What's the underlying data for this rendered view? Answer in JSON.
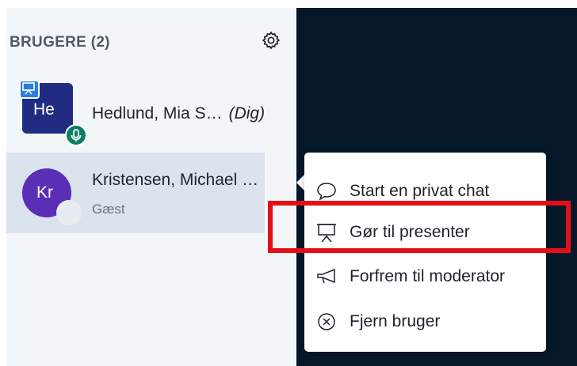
{
  "users_panel": {
    "title": "BRUGERE (2)",
    "users": [
      {
        "initials": "He",
        "name": "Hedlund, Mia S…",
        "you_tag": "(Dig)",
        "avatar_color": "#1f2c82",
        "is_presenter": true,
        "mic_active": true
      },
      {
        "initials": "Kr",
        "name": "Kristensen, Michael …",
        "role": "Gæst",
        "avatar_color": "#5a2fb6"
      }
    ]
  },
  "context_menu": {
    "items": [
      {
        "label": "Start en privat chat",
        "icon": "chat-bubble-icon"
      },
      {
        "label": "Gør til presenter",
        "icon": "presentation-board-icon"
      },
      {
        "label": "Forfrem til moderator",
        "icon": "megaphone-icon"
      },
      {
        "label": "Fjern bruger",
        "icon": "remove-circle-icon"
      }
    ]
  },
  "colors": {
    "highlight": "#e40f16",
    "dark_background": "#06172a",
    "panel_background": "#f3f6f9",
    "selected_row": "#dbe3ec"
  }
}
